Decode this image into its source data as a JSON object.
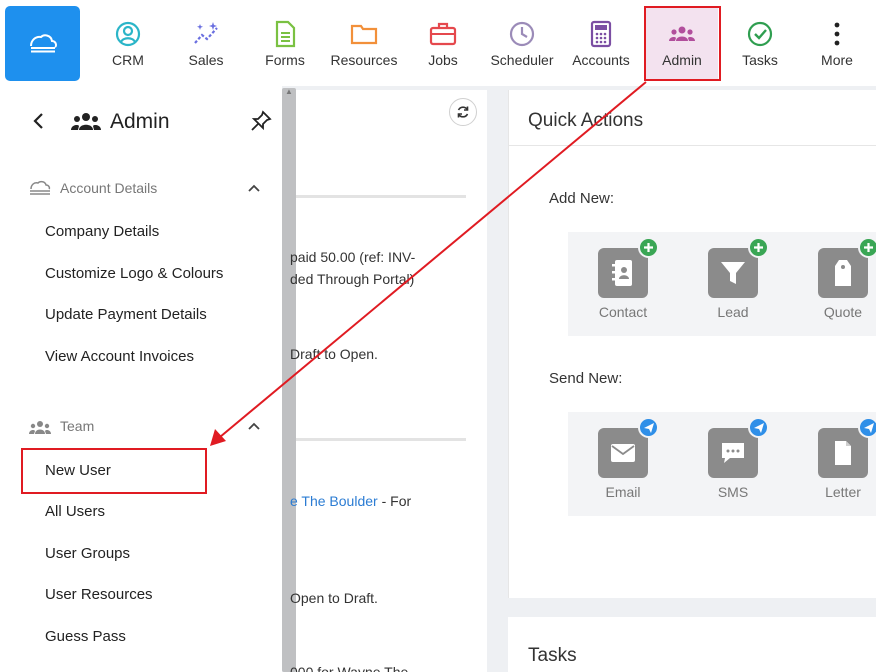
{
  "nav": {
    "items": [
      {
        "label": "CRM",
        "icon": "person-circle-icon"
      },
      {
        "label": "Sales",
        "icon": "sparkle-chart-icon"
      },
      {
        "label": "Forms",
        "icon": "document-icon"
      },
      {
        "label": "Resources",
        "icon": "folder-icon"
      },
      {
        "label": "Jobs",
        "icon": "briefcase-icon"
      },
      {
        "label": "Scheduler",
        "icon": "clock-icon"
      },
      {
        "label": "Accounts",
        "icon": "calculator-icon"
      },
      {
        "label": "Admin",
        "icon": "group-icon"
      },
      {
        "label": "Tasks",
        "icon": "check-circle-icon"
      },
      {
        "label": "More",
        "icon": "vertical-dots-icon"
      }
    ],
    "active": "Admin"
  },
  "sidebar": {
    "title": "Admin",
    "sections": [
      {
        "title": "Account Details",
        "items": [
          "Company Details",
          "Customize Logo & Colours",
          "Update Payment Details",
          "View Account Invoices"
        ]
      },
      {
        "title": "Team",
        "items": [
          "New User",
          "All Users",
          "User Groups",
          "User Resources",
          "Guess Pass"
        ]
      }
    ]
  },
  "middle": {
    "lines": [
      "paid 50.00 (ref: INV-",
      "ded Through Portal)",
      "Draft to Open.",
      "e The Boulder",
      " - For",
      "Open to Draft.",
      "000 for Wayne The"
    ]
  },
  "quick_actions": {
    "title": "Quick Actions",
    "add_new_label": "Add New:",
    "add_new": [
      "Contact",
      "Lead",
      "Quote"
    ],
    "send_new_label": "Send New:",
    "send_new": [
      "Email",
      "SMS",
      "Letter"
    ]
  },
  "tasks": {
    "title": "Tasks"
  },
  "colors": {
    "brand": "#1e90ee",
    "active_bg": "#f3e2ef",
    "highlight": "#e01b22",
    "add_badge": "#3aa655",
    "send_badge": "#2f8fe8"
  }
}
